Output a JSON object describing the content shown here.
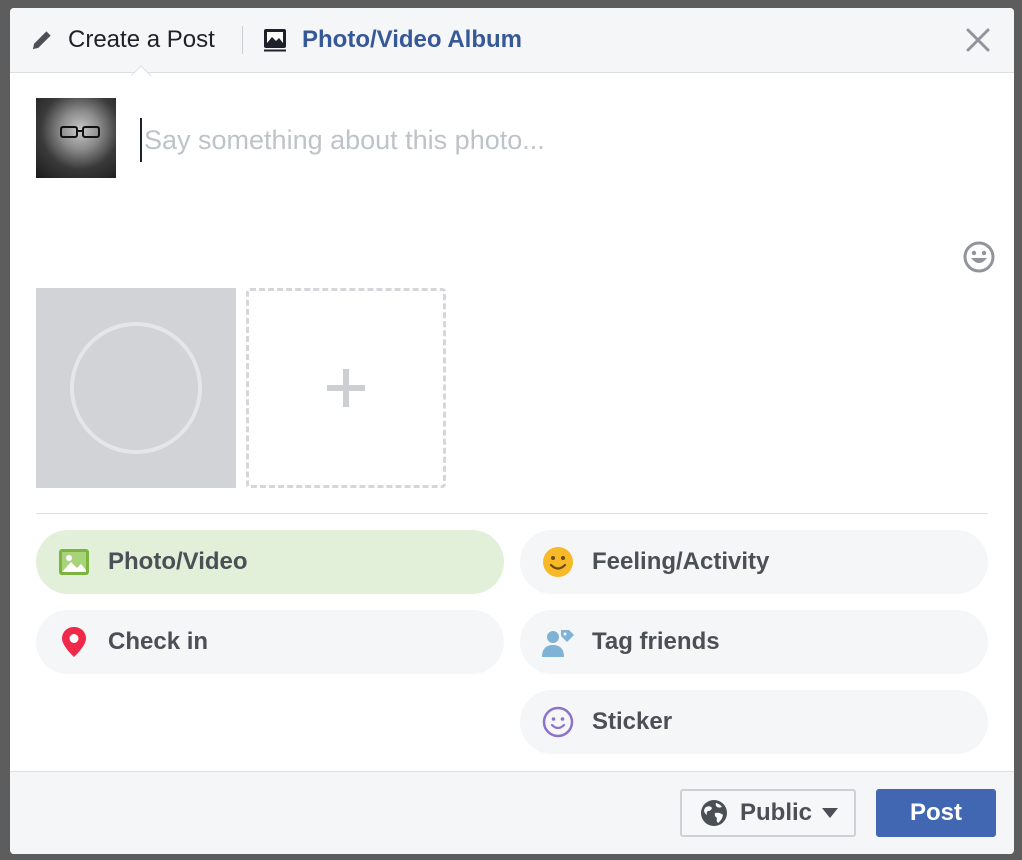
{
  "header": {
    "create_tab": {
      "label": "Create a Post",
      "icon": "pencil-icon"
    },
    "album_tab": {
      "label": "Photo/Video Album",
      "icon": "album-icon"
    },
    "close_icon": "close-icon"
  },
  "composer": {
    "placeholder": "Say something about this photo...",
    "value": "",
    "emoji_icon": "smiley-icon"
  },
  "media": {
    "add_icon": "plus-icon"
  },
  "options": {
    "photo_video": {
      "label": "Photo/Video",
      "icon": "photo-icon",
      "color": "#7bb53e",
      "active": true
    },
    "feeling": {
      "label": "Feeling/Activity",
      "icon": "smiley-icon",
      "color": "#f7b928"
    },
    "checkin": {
      "label": "Check in",
      "icon": "location-pin-icon",
      "color": "#f02849"
    },
    "tag_friends": {
      "label": "Tag friends",
      "icon": "tag-person-icon",
      "color": "#7fb3d5"
    },
    "sticker": {
      "label": "Sticker",
      "icon": "sticker-icon",
      "color": "#8c72cb"
    }
  },
  "footer": {
    "audience": {
      "label": "Public",
      "icon": "globe-icon"
    },
    "post_label": "Post"
  },
  "colors": {
    "accent": "#4267b2",
    "link": "#365899"
  }
}
